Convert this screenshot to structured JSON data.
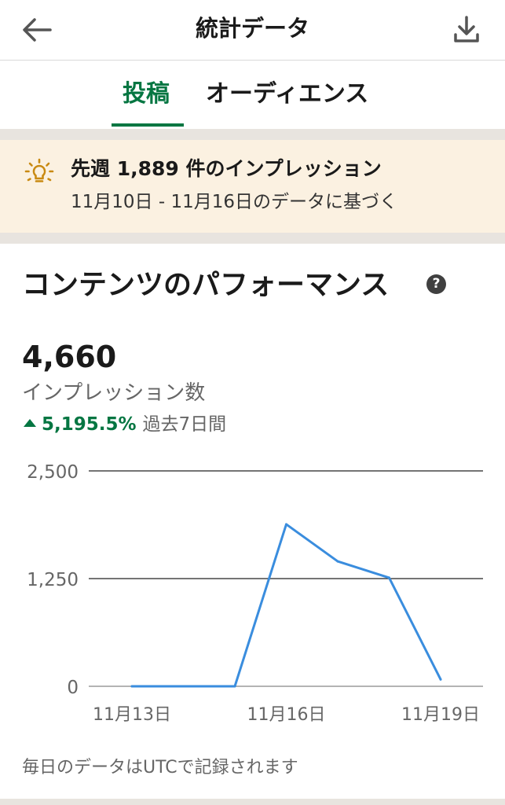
{
  "header": {
    "title": "統計データ",
    "back_icon": "arrow-left-icon",
    "download_icon": "download-icon"
  },
  "tabs": [
    {
      "label": "投稿",
      "active": true
    },
    {
      "label": "オーディエンス",
      "active": false
    }
  ],
  "banner": {
    "icon": "lightbulb-icon",
    "title": "先週 1,889 件のインプレッション",
    "subtitle": "11月10日 - 11月16日のデータに基づく"
  },
  "section": {
    "title": "コンテンツのパフォーマンス",
    "help_icon": "help-icon",
    "help_glyph": "?"
  },
  "metric": {
    "value": "4,660",
    "label": "インプレッション数",
    "change": "5,195.5%",
    "change_period": "過去7日間"
  },
  "colors": {
    "accent": "#057642",
    "line": "#3a8dde",
    "banner_bg": "#fbf1e1",
    "band": "#e8e4df"
  },
  "chart_data": {
    "type": "line",
    "x": [
      "11月13日",
      "11月14日",
      "11月15日",
      "11月16日",
      "11月17日",
      "11月18日",
      "11月19日"
    ],
    "series": [
      {
        "values": [
          0,
          0,
          0,
          1880,
          1450,
          1260,
          80
        ]
      }
    ],
    "ylim": [
      0,
      2500
    ],
    "yticks": [
      0,
      1250,
      2500
    ],
    "ytick_labels": [
      "0",
      "1,250",
      "2,500"
    ],
    "xtick_labels": [
      "11月13日",
      "11月16日",
      "11月19日"
    ],
    "xtick_index": [
      0,
      3,
      6
    ],
    "grid": true
  },
  "footer_note": "毎日のデータはUTCで記録されます"
}
